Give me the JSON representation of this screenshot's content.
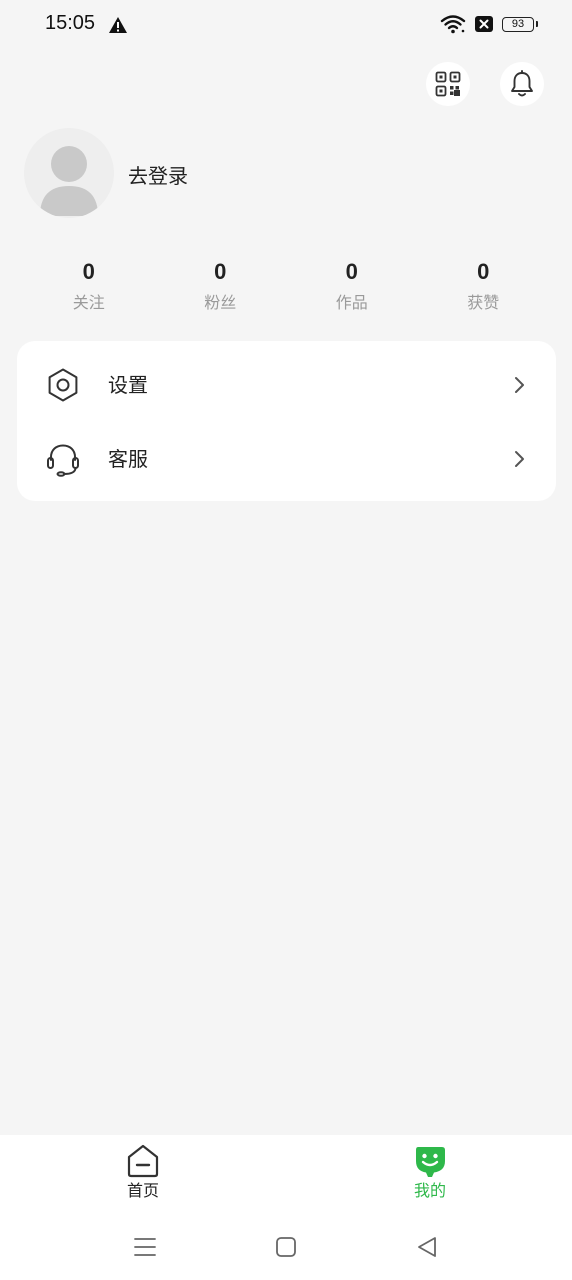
{
  "status_bar": {
    "time": "15:05",
    "battery": "93",
    "icons": [
      "alert-triangle-icon",
      "wifi-icon",
      "sim-blocked-icon",
      "battery-icon"
    ]
  },
  "header": {
    "qr_icon": "qr-code-icon",
    "bell_icon": "bell-icon"
  },
  "profile": {
    "avatar_icon": "default-avatar-icon",
    "login_text": "去登录"
  },
  "stats": [
    {
      "value": "0",
      "label": "关注"
    },
    {
      "value": "0",
      "label": "粉丝"
    },
    {
      "value": "0",
      "label": "作品"
    },
    {
      "value": "0",
      "label": "获赞"
    }
  ],
  "menu": [
    {
      "label": "设置",
      "icon": "settings-gear-icon"
    },
    {
      "label": "客服",
      "icon": "headset-icon"
    }
  ],
  "tabbar": {
    "home": {
      "label": "首页",
      "icon": "home-tab-icon"
    },
    "mine": {
      "label": "我的",
      "icon": "mine-tab-icon",
      "active": true
    }
  },
  "colors": {
    "accent": "#2eb84a",
    "background": "#f5f5f5",
    "label_gray": "#9a9a9a"
  }
}
